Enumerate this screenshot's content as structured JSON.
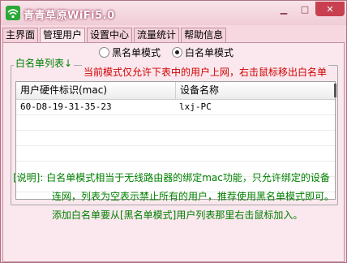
{
  "app": {
    "title": "青青草原WiFi5.0",
    "min_glyph": "▁",
    "max_glyph": "□",
    "close_glyph": "✕"
  },
  "tabs": [
    {
      "label": "主界面"
    },
    {
      "label": "管理用户"
    },
    {
      "label": "设置中心"
    },
    {
      "label": "流量统计"
    },
    {
      "label": "帮助信息"
    }
  ],
  "mode": {
    "blacklist_label": "黑名单模式",
    "whitelist_label": "白名单模式",
    "selected": "whitelist"
  },
  "whitelist": {
    "group_label": "白名单列表",
    "group_arrow": "↓",
    "notice": "当前模式仅允许下表中的用户上网，右击鼠标移出白名单"
  },
  "table": {
    "columns": [
      "用户硬件标识(mac)",
      "设备名称"
    ],
    "rows": [
      [
        "60-D8-19-31-35-23",
        "lxj-PC"
      ]
    ]
  },
  "info": {
    "lines": [
      "[说明]: 白名单模式相当于无线路由器的绑定mac功能，只允许绑定的设备",
      "连网，列表为空表示禁止所有的用户，推荐使用黑名单模式即可。",
      "添加白名单要从[黑名单模式]用户列表那里右击鼠标加入。"
    ]
  },
  "colors": {
    "background": "#f8d8e0",
    "notice": "#d00000",
    "info": "#008000",
    "close": "#c84050"
  }
}
